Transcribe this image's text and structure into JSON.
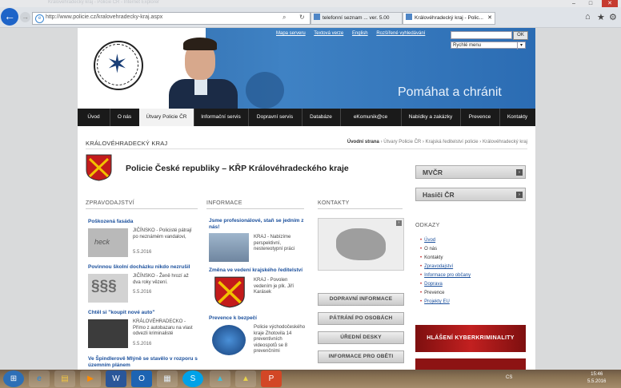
{
  "browser": {
    "title": "Královéhradecký kraj - Policie ČR - Internet Explorer",
    "address": "http://www.policie.cz/kralovehradecky-kraj.aspx",
    "tabs": [
      {
        "label": "telefonní seznam ... ver. 5.00"
      },
      {
        "label": "Královéhradecký kraj - Polic..."
      }
    ],
    "back_glyph": "←",
    "fwd_glyph": "→",
    "min": "–",
    "max": "□",
    "close": "✕",
    "search_glyph": "⌕",
    "refresh_glyph": "↻",
    "tab_close": "✕",
    "home": "⌂",
    "fav": "★",
    "settings": "⚙"
  },
  "header": {
    "logo_star": "✶",
    "top_links": [
      "Mapa serveru",
      "Textová verze",
      "English",
      "Rozšířené vyhledávání"
    ],
    "search_button": "OK",
    "quick_menu": "Rychlé menu",
    "quick_arrow": "▾",
    "slogan": "Pomáhat a chránit"
  },
  "nav": [
    "Úvod",
    "O nás",
    "Útvary Policie ČR",
    "Informační servis",
    "Dopravní servis",
    "Databáze",
    "eKomunik@ce",
    "Nabídky a zakázky",
    "Prevence",
    "Kontakty"
  ],
  "region": "KRÁLOVÉHRADECKÝ KRAJ",
  "breadcrumb": {
    "items": [
      "Úvodní strana",
      "Útvary Policie ČR",
      "Krajská ředitelství policie",
      "Královéhradecký kraj"
    ],
    "sep": "›"
  },
  "page_title": "Policie České republiky – KŘP Královéhradeckého kraje",
  "side_buttons": [
    {
      "label": "MVČR"
    },
    {
      "label": "Hasiči ČR"
    }
  ],
  "side_arrow": "›",
  "sections": {
    "news": "ZPRAVODAJSTVÍ",
    "info": "INFORMACE",
    "contacts": "KONTAKTY"
  },
  "news": [
    {
      "title": "Poškozená fasáda",
      "text": "JIČÍNSKO - Policisté pátrají po neznámém vandalovi,",
      "date": "5.5.2016"
    },
    {
      "title": "Povinnou školní docházku nikdo nezrušil",
      "text": "JIČÍNSKO - Ženě hrozí až dva roky vězení.",
      "date": "5.5.2016"
    },
    {
      "title": "Chtěl si \"koupit nové auto\"",
      "text": "KRÁLOVÉHRADECKO - Přímo z autobazaru na vlast odvezli kriminalisté",
      "date": "5.5.2016"
    },
    {
      "title": "Ve Špindlerově Mlýně se stavělo v rozporu s územním plánem",
      "text": "",
      "date": ""
    }
  ],
  "thumb_texts": {
    "scribble": "heck",
    "paragraph": "§§§"
  },
  "info": [
    {
      "title": "Jsme profesionálové, staň se jedním z nás!",
      "text": "KRAJ - Nabízíme perspektivní, nestereotypní práci"
    },
    {
      "title": "Změna ve vedení krajského ředitelství",
      "text": "KRAJ - Povolen vedením je plk. Jiří Karásek"
    },
    {
      "title": "Prevence k bezpečí",
      "text": "Policie východočeského kraje Zhotovila 14 preventivních videospotů se 8 prevenčními"
    }
  ],
  "contact_buttons": [
    "DOPRAVNÍ INFORMACE",
    "PÁTRÁNÍ PO OSOBÁCH",
    "ÚŘEDNÍ DESKY",
    "INFORMACE PRO OBĚTI"
  ],
  "links_heading": "ODKAZY",
  "links": [
    "Úvod",
    "O nás",
    "Kontakty",
    "Zpravodajství",
    "Informace pro občany",
    "Doprava",
    "Prevence",
    "Projekty EU"
  ],
  "cyber_banner": "HLÁŠENÍ KYBERKRIMINALITY",
  "taskbar": {
    "start": "⊞",
    "apps": [
      "e",
      "▤",
      "▶",
      "W",
      "O",
      "▦",
      "S",
      "▲",
      "▲",
      "P"
    ],
    "lang": "CS",
    "time": "15:46",
    "date": "5.5.2016"
  }
}
